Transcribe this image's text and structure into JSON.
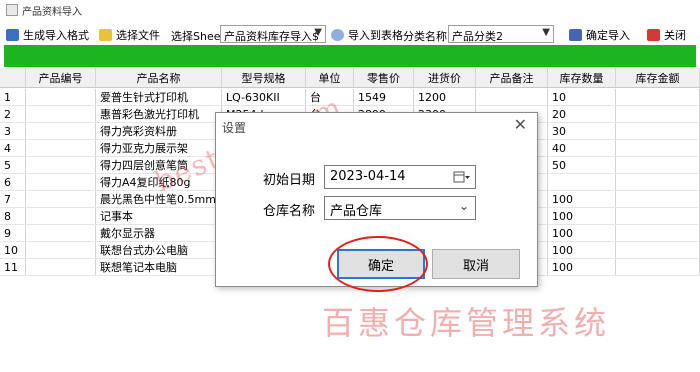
{
  "window": {
    "title": "产品资料导入"
  },
  "toolbar": {
    "gen_format_label": "生成导入格式",
    "choose_file_label": "选择文件",
    "sheet_label": "选择Sheet",
    "sheet_value": "产品资料库存导入$",
    "import_to_table_label": "导入到表格",
    "category_label": "分类名称",
    "category_value": "产品分类2",
    "confirm_import_label": "确定导入",
    "close_label": "关闭"
  },
  "table": {
    "headers": [
      "",
      "产品编号",
      "产品名称",
      "型号规格",
      "单位",
      "零售价",
      "进货价",
      "产品备注",
      "库存数量",
      "库存金额"
    ],
    "rows": [
      [
        "1",
        "",
        "爱普生针式打印机",
        "LQ-630KII",
        "台",
        "1549",
        "1200",
        "",
        "10",
        ""
      ],
      [
        "2",
        "",
        "惠普彩色激光打印机",
        "M254dw",
        "台",
        "2899",
        "2300",
        "",
        "20",
        ""
      ],
      [
        "3",
        "",
        "得力亮彩资料册",
        "",
        "",
        "",
        "",
        "",
        "30",
        ""
      ],
      [
        "4",
        "",
        "得力亚克力展示架",
        "",
        "",
        "",
        "",
        "",
        "40",
        ""
      ],
      [
        "5",
        "",
        "得力四层创意笔筒",
        "",
        "",
        "",
        "",
        "",
        "50",
        ""
      ],
      [
        "6",
        "",
        "得力A4复印纸80g",
        "",
        "",
        "",
        "",
        "",
        "",
        ""
      ],
      [
        "7",
        "",
        "晨光黑色中性笔0.5mm",
        "",
        "",
        "",
        "",
        "",
        "100",
        ""
      ],
      [
        "8",
        "",
        "记事本",
        "",
        "",
        "",
        "",
        "",
        "100",
        ""
      ],
      [
        "9",
        "",
        "戴尔显示器",
        "",
        "",
        "",
        "",
        "",
        "100",
        ""
      ],
      [
        "10",
        "",
        "联想台式办公电脑",
        "",
        "",
        "",
        "",
        "",
        "100",
        ""
      ],
      [
        "11",
        "",
        "联想笔记本电脑",
        "",
        "",
        "",
        "",
        "",
        "100",
        ""
      ]
    ]
  },
  "watermark": {
    "site": "bestshd.com",
    "brand": "百惠仓库管理系统"
  },
  "dialog": {
    "title": "设置",
    "close_glyph": "✕",
    "date_label": "初始日期",
    "date_value": "2023-04-14",
    "warehouse_label": "仓库名称",
    "warehouse_value": "产品仓库",
    "ok_label": "确定",
    "cancel_label": "取消"
  },
  "colors": {
    "progress_bar": "#1db51d",
    "highlight": "#e02020",
    "button_focus": "#2a78d0"
  }
}
